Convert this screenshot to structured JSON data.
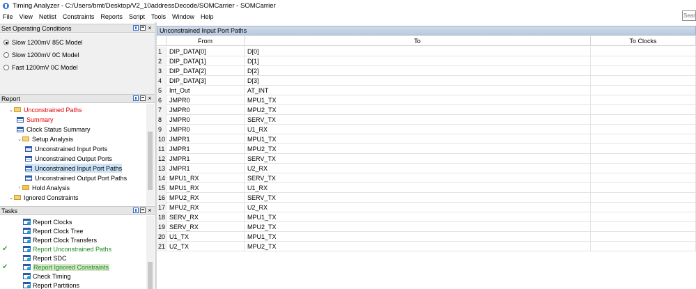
{
  "window": {
    "title": "Timing Analyzer - C:/Users/bmt/Desktop/V2_10addressDecode/SOMCarrier - SOMCarrier"
  },
  "menu": [
    "File",
    "View",
    "Netlist",
    "Constraints",
    "Reports",
    "Script",
    "Tools",
    "Window",
    "Help"
  ],
  "search": {
    "placeholder": "Search"
  },
  "operating_conditions": {
    "title": "Set Operating Conditions",
    "options": [
      {
        "label": "Slow 1200mV 85C Model",
        "selected": true
      },
      {
        "label": "Slow 1200mV 0C Model",
        "selected": false
      },
      {
        "label": "Fast 1200mV 0C Model",
        "selected": false
      }
    ]
  },
  "report": {
    "title": "Report",
    "tree": [
      {
        "label": "Unconstrained Paths",
        "kind": "folder-open",
        "level": 1,
        "red": true
      },
      {
        "label": "Summary",
        "kind": "table",
        "level": 2,
        "red": true
      },
      {
        "label": "Clock Status Summary",
        "kind": "table",
        "level": 2
      },
      {
        "label": "Setup Analysis",
        "kind": "folder-open",
        "level": 2
      },
      {
        "label": "Unconstrained Input Ports",
        "kind": "table",
        "level": 3
      },
      {
        "label": "Unconstrained Output Ports",
        "kind": "table",
        "level": 3
      },
      {
        "label": "Unconstrained Input Port Paths",
        "kind": "table",
        "level": 3,
        "selected": true
      },
      {
        "label": "Unconstrained Output Port Paths",
        "kind": "table",
        "level": 3
      },
      {
        "label": "Hold Analysis",
        "kind": "folder-closed",
        "level": 2
      },
      {
        "label": "Ignored Constraints",
        "kind": "folder-open",
        "level": 1
      }
    ]
  },
  "tasks": {
    "title": "Tasks",
    "items": [
      {
        "label": "Report Clocks"
      },
      {
        "label": "Report Clock Tree"
      },
      {
        "label": "Report Clock Transfers"
      },
      {
        "label": "Report Unconstrained Paths",
        "done": true
      },
      {
        "label": "Report SDC"
      },
      {
        "label": "Report Ignored Constraints",
        "done": true,
        "highlight": true
      },
      {
        "label": "Check Timing"
      },
      {
        "label": "Report Partitions"
      }
    ]
  },
  "main": {
    "title": "Unconstrained Input Port Paths",
    "columns": [
      "",
      "From",
      "To",
      "To Clocks"
    ],
    "rows": [
      [
        "1",
        "DIP_DATA[0]",
        "D[0]",
        ""
      ],
      [
        "2",
        "DIP_DATA[1]",
        "D[1]",
        ""
      ],
      [
        "3",
        "DIP_DATA[2]",
        "D[2]",
        ""
      ],
      [
        "4",
        "DIP_DATA[3]",
        "D[3]",
        ""
      ],
      [
        "5",
        "Int_Out",
        "AT_INT",
        ""
      ],
      [
        "6",
        "JMPR0",
        "MPU1_TX",
        ""
      ],
      [
        "7",
        "JMPR0",
        "MPU2_TX",
        ""
      ],
      [
        "8",
        "JMPR0",
        "SERV_TX",
        ""
      ],
      [
        "9",
        "JMPR0",
        "U1_RX",
        ""
      ],
      [
        "10",
        "JMPR1",
        "MPU1_TX",
        ""
      ],
      [
        "11",
        "JMPR1",
        "MPU2_TX",
        ""
      ],
      [
        "12",
        "JMPR1",
        "SERV_TX",
        ""
      ],
      [
        "13",
        "JMPR1",
        "U2_RX",
        ""
      ],
      [
        "14",
        "MPU1_RX",
        "SERV_TX",
        ""
      ],
      [
        "15",
        "MPU1_RX",
        "U1_RX",
        ""
      ],
      [
        "16",
        "MPU2_RX",
        "SERV_TX",
        ""
      ],
      [
        "17",
        "MPU2_RX",
        "U2_RX",
        ""
      ],
      [
        "18",
        "SERV_RX",
        "MPU1_TX",
        ""
      ],
      [
        "19",
        "SERV_RX",
        "MPU2_TX",
        ""
      ],
      [
        "20",
        "U1_TX",
        "MPU1_TX",
        ""
      ],
      [
        "21",
        "U2_TX",
        "MPU2_TX",
        ""
      ]
    ]
  },
  "colors": {
    "selected_row": "#cde4f7",
    "red_text": "#e00000",
    "done_green": "#1f8a1f",
    "header_blue": "#c3d2e6"
  }
}
